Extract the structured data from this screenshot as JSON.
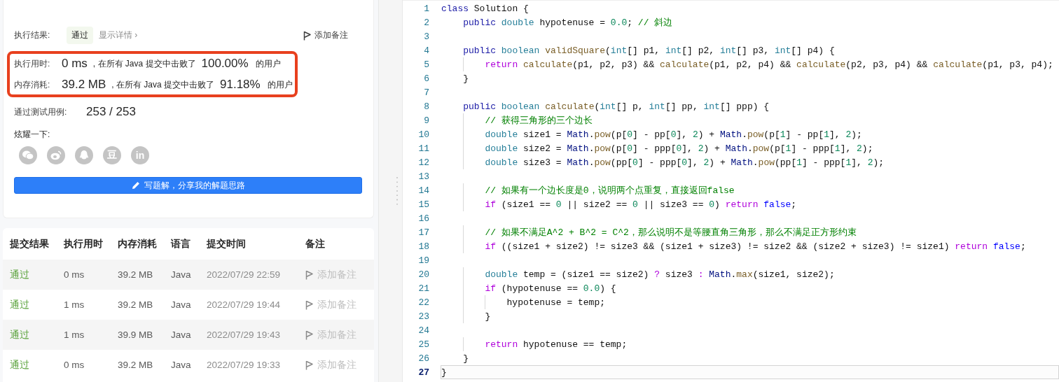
{
  "result": {
    "label": "执行结果:",
    "status": "通过",
    "details_link": "显示详情 ›",
    "add_note": "添加备注"
  },
  "stats_frame": {
    "highlighted": true
  },
  "stats": [
    {
      "label": "执行用时:",
      "value": "0 ms",
      "text": ", 在所有 Java 提交中击败了",
      "percent": "100.00%",
      "suffix": "的用户"
    },
    {
      "label": "内存消耗:",
      "value": "39.2 MB",
      "text": ", 在所有 Java 提交中击败了",
      "percent": "91.18%",
      "suffix": "的用户"
    }
  ],
  "tests": {
    "label": "通过测试用例:",
    "value": "253 / 253"
  },
  "share": {
    "label": "炫耀一下:",
    "buttons": [
      {
        "kind": "wechat"
      },
      {
        "kind": "weibo"
      },
      {
        "kind": "qq"
      },
      {
        "kind": "glyph",
        "glyph": "豆"
      },
      {
        "kind": "glyph",
        "glyph": "in"
      }
    ]
  },
  "write_button": "写题解，分享我的解题思路",
  "submissions": {
    "columns": [
      "提交结果",
      "执行用时",
      "内存消耗",
      "语言",
      "提交时间",
      "备注"
    ],
    "rows": [
      {
        "status": "通过",
        "time": "0 ms",
        "memory": "39.2 MB",
        "language": "Java",
        "submitted": "2022/07/29 22:59",
        "note": "添加备注"
      },
      {
        "status": "通过",
        "time": "1 ms",
        "memory": "39.2 MB",
        "language": "Java",
        "submitted": "2022/07/29 19:44",
        "note": "添加备注"
      },
      {
        "status": "通过",
        "time": "1 ms",
        "memory": "39.9 MB",
        "language": "Java",
        "submitted": "2022/07/29 19:43",
        "note": "添加备注"
      },
      {
        "status": "通过",
        "time": "0 ms",
        "memory": "39.2 MB",
        "language": "Java",
        "submitted": "2022/07/29 19:33",
        "note": "添加备注"
      }
    ]
  },
  "editor": {
    "lines": [
      {
        "number": "1",
        "active": false,
        "tokens": [
          {
            "kind": "kw",
            "text": "class"
          },
          {
            "kind": "plain",
            "text": " Solution {"
          }
        ]
      },
      {
        "number": "2",
        "active": false,
        "tokens": [
          {
            "kind": "kw",
            "text": "    public "
          },
          {
            "kind": "type",
            "text": "double"
          },
          {
            "kind": "plain",
            "text": " hypotenuse = "
          },
          {
            "kind": "num",
            "text": "0.0"
          },
          {
            "kind": "plain",
            "text": "; "
          },
          {
            "kind": "comment",
            "text": "// 斜边"
          }
        ]
      },
      {
        "number": "3",
        "active": false
      },
      {
        "number": "4",
        "active": false,
        "tokens": [
          {
            "kind": "kw",
            "text": "    public "
          },
          {
            "kind": "type",
            "text": "boolean "
          },
          {
            "kind": "fn",
            "text": "validSquare"
          },
          {
            "kind": "plain",
            "text": "("
          },
          {
            "kind": "type",
            "text": "int"
          },
          {
            "kind": "plain",
            "text": "[] p1, "
          },
          {
            "kind": "type",
            "text": "int"
          },
          {
            "kind": "plain",
            "text": "[] p2, "
          },
          {
            "kind": "type",
            "text": "int"
          },
          {
            "kind": "plain",
            "text": "[] p3, "
          },
          {
            "kind": "type",
            "text": "int"
          },
          {
            "kind": "plain",
            "text": "[] p4) {"
          }
        ]
      },
      {
        "number": "5",
        "active": false,
        "tokens": [
          {
            "kind": "ctrl",
            "text": "        return "
          },
          {
            "kind": "fn",
            "text": "calculate"
          },
          {
            "kind": "plain",
            "text": "(p1, p2, p3) && "
          },
          {
            "kind": "fn",
            "text": "calculate"
          },
          {
            "kind": "plain",
            "text": "(p1, p2, p4) && "
          },
          {
            "kind": "fn",
            "text": "calculate"
          },
          {
            "kind": "plain",
            "text": "(p2, p3, p4) && "
          },
          {
            "kind": "fn",
            "text": "calculate"
          },
          {
            "kind": "plain",
            "text": "(p1, p3, p4);"
          }
        ]
      },
      {
        "number": "6",
        "active": false,
        "tokens": [
          {
            "kind": "plain",
            "text": "    }"
          }
        ]
      },
      {
        "number": "7",
        "active": false
      },
      {
        "number": "8",
        "active": false,
        "tokens": [
          {
            "kind": "kw",
            "text": "    public "
          },
          {
            "kind": "type",
            "text": "boolean "
          },
          {
            "kind": "fn",
            "text": "calculate"
          },
          {
            "kind": "plain",
            "text": "("
          },
          {
            "kind": "type",
            "text": "int"
          },
          {
            "kind": "plain",
            "text": "[] p, "
          },
          {
            "kind": "type",
            "text": "int"
          },
          {
            "kind": "plain",
            "text": "[] pp, "
          },
          {
            "kind": "type",
            "text": "int"
          },
          {
            "kind": "plain",
            "text": "[] ppp) {"
          }
        ]
      },
      {
        "number": "9",
        "active": false,
        "tokens": [
          {
            "kind": "comment",
            "text": "        // 获得三角形的三个边长"
          }
        ]
      },
      {
        "number": "10",
        "active": false,
        "tokens": [
          {
            "kind": "type",
            "text": "        double"
          },
          {
            "kind": "plain",
            "text": " size1 = "
          },
          {
            "kind": "cls",
            "text": "Math"
          },
          {
            "kind": "plain",
            "text": "."
          },
          {
            "kind": "fn",
            "text": "pow"
          },
          {
            "kind": "plain",
            "text": "(p["
          },
          {
            "kind": "num",
            "text": "0"
          },
          {
            "kind": "plain",
            "text": "] - pp["
          },
          {
            "kind": "num",
            "text": "0"
          },
          {
            "kind": "plain",
            "text": "], "
          },
          {
            "kind": "num",
            "text": "2"
          },
          {
            "kind": "plain",
            "text": ") + "
          },
          {
            "kind": "cls",
            "text": "Math"
          },
          {
            "kind": "plain",
            "text": "."
          },
          {
            "kind": "fn",
            "text": "pow"
          },
          {
            "kind": "plain",
            "text": "(p["
          },
          {
            "kind": "num",
            "text": "1"
          },
          {
            "kind": "plain",
            "text": "] - pp["
          },
          {
            "kind": "num",
            "text": "1"
          },
          {
            "kind": "plain",
            "text": "], "
          },
          {
            "kind": "num",
            "text": "2"
          },
          {
            "kind": "plain",
            "text": ");"
          }
        ]
      },
      {
        "number": "11",
        "active": false,
        "tokens": [
          {
            "kind": "type",
            "text": "        double"
          },
          {
            "kind": "plain",
            "text": " size2 = "
          },
          {
            "kind": "cls",
            "text": "Math"
          },
          {
            "kind": "plain",
            "text": "."
          },
          {
            "kind": "fn",
            "text": "pow"
          },
          {
            "kind": "plain",
            "text": "(p["
          },
          {
            "kind": "num",
            "text": "0"
          },
          {
            "kind": "plain",
            "text": "] - ppp["
          },
          {
            "kind": "num",
            "text": "0"
          },
          {
            "kind": "plain",
            "text": "], "
          },
          {
            "kind": "num",
            "text": "2"
          },
          {
            "kind": "plain",
            "text": ") + "
          },
          {
            "kind": "cls",
            "text": "Math"
          },
          {
            "kind": "plain",
            "text": "."
          },
          {
            "kind": "fn",
            "text": "pow"
          },
          {
            "kind": "plain",
            "text": "(p["
          },
          {
            "kind": "num",
            "text": "1"
          },
          {
            "kind": "plain",
            "text": "] - ppp["
          },
          {
            "kind": "num",
            "text": "1"
          },
          {
            "kind": "plain",
            "text": "], "
          },
          {
            "kind": "num",
            "text": "2"
          },
          {
            "kind": "plain",
            "text": ");"
          }
        ]
      },
      {
        "number": "12",
        "active": false,
        "tokens": [
          {
            "kind": "type",
            "text": "        double"
          },
          {
            "kind": "plain",
            "text": " size3 = "
          },
          {
            "kind": "cls",
            "text": "Math"
          },
          {
            "kind": "plain",
            "text": "."
          },
          {
            "kind": "fn",
            "text": "pow"
          },
          {
            "kind": "plain",
            "text": "(pp["
          },
          {
            "kind": "num",
            "text": "0"
          },
          {
            "kind": "plain",
            "text": "] - ppp["
          },
          {
            "kind": "num",
            "text": "0"
          },
          {
            "kind": "plain",
            "text": "], "
          },
          {
            "kind": "num",
            "text": "2"
          },
          {
            "kind": "plain",
            "text": ") + "
          },
          {
            "kind": "cls",
            "text": "Math"
          },
          {
            "kind": "plain",
            "text": "."
          },
          {
            "kind": "fn",
            "text": "pow"
          },
          {
            "kind": "plain",
            "text": "(pp["
          },
          {
            "kind": "num",
            "text": "1"
          },
          {
            "kind": "plain",
            "text": "] - ppp["
          },
          {
            "kind": "num",
            "text": "1"
          },
          {
            "kind": "plain",
            "text": "], "
          },
          {
            "kind": "num",
            "text": "2"
          },
          {
            "kind": "plain",
            "text": ");"
          }
        ]
      },
      {
        "number": "13",
        "active": false
      },
      {
        "number": "14",
        "active": false,
        "tokens": [
          {
            "kind": "comment",
            "text": "        // 如果有一个边长度是0，说明两个点重复，直接返回false"
          }
        ]
      },
      {
        "number": "15",
        "active": false,
        "tokens": [
          {
            "kind": "ctrl",
            "text": "        if"
          },
          {
            "kind": "plain",
            "text": " (size1 == "
          },
          {
            "kind": "num",
            "text": "0"
          },
          {
            "kind": "plain",
            "text": " || size2 == "
          },
          {
            "kind": "num",
            "text": "0"
          },
          {
            "kind": "plain",
            "text": " || size3 == "
          },
          {
            "kind": "num",
            "text": "0"
          },
          {
            "kind": "plain",
            "text": ") "
          },
          {
            "kind": "ctrl",
            "text": "return "
          },
          {
            "kind": "bool",
            "text": "false"
          },
          {
            "kind": "plain",
            "text": ";"
          }
        ]
      },
      {
        "number": "16",
        "active": false
      },
      {
        "number": "17",
        "active": false,
        "tokens": [
          {
            "kind": "comment",
            "text": "        // 如果不满足A^2 + B^2 = C^2，那么说明不是等腰直角三角形，那么不满足正方形约束"
          }
        ]
      },
      {
        "number": "18",
        "active": false,
        "tokens": [
          {
            "kind": "ctrl",
            "text": "        if"
          },
          {
            "kind": "plain",
            "text": " ((size1 + size2) != size3 && (size1 + size3) != size2 && (size2 + size3) != size1) "
          },
          {
            "kind": "ctrl",
            "text": "return "
          },
          {
            "kind": "bool",
            "text": "false"
          },
          {
            "kind": "plain",
            "text": ";"
          }
        ]
      },
      {
        "number": "19",
        "active": false
      },
      {
        "number": "20",
        "active": false,
        "tokens": [
          {
            "kind": "type",
            "text": "        double"
          },
          {
            "kind": "plain",
            "text": " temp = (size1 == size2) "
          },
          {
            "kind": "ctrl",
            "text": "?"
          },
          {
            "kind": "plain",
            "text": " size3 "
          },
          {
            "kind": "ctrl",
            "text": ": "
          },
          {
            "kind": "cls",
            "text": "Math"
          },
          {
            "kind": "plain",
            "text": "."
          },
          {
            "kind": "fn",
            "text": "max"
          },
          {
            "kind": "plain",
            "text": "(size1, size2);"
          }
        ]
      },
      {
        "number": "21",
        "active": false,
        "tokens": [
          {
            "kind": "ctrl",
            "text": "        if"
          },
          {
            "kind": "plain",
            "text": " (hypotenuse == "
          },
          {
            "kind": "num",
            "text": "0.0"
          },
          {
            "kind": "plain",
            "text": ") {"
          }
        ]
      },
      {
        "number": "22",
        "active": false,
        "tokens": [
          {
            "kind": "plain",
            "text": "            hypotenuse = temp;"
          }
        ]
      },
      {
        "number": "23",
        "active": false,
        "tokens": [
          {
            "kind": "plain",
            "text": "        }"
          }
        ]
      },
      {
        "number": "24",
        "active": false
      },
      {
        "number": "25",
        "active": false,
        "tokens": [
          {
            "kind": "ctrl",
            "text": "        return"
          },
          {
            "kind": "plain",
            "text": " hypotenuse == temp;"
          }
        ]
      },
      {
        "number": "26",
        "active": false,
        "tokens": [
          {
            "kind": "plain",
            "text": "    }"
          }
        ]
      },
      {
        "number": "27",
        "active": true,
        "tokens": [
          {
            "kind": "plain",
            "text": "}"
          }
        ]
      }
    ]
  }
}
